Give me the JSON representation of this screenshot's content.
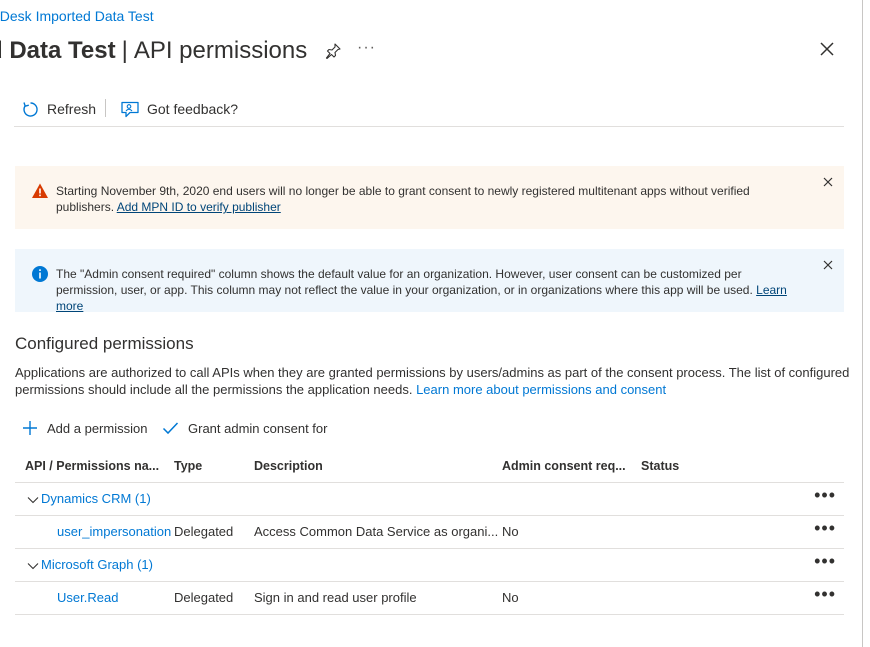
{
  "breadcrumb": "nDesk Imported Data Test",
  "title": {
    "main": "d Data Test",
    "separator": "|",
    "sub": "API permissions"
  },
  "header_icons": {
    "pin": "pin-icon",
    "more": "···",
    "close": "close-icon"
  },
  "toolbar": {
    "refresh_label": "Refresh",
    "feedback_label": "Got feedback?"
  },
  "warning_banner": {
    "text": "Starting November 9th, 2020 end users will no longer be able to grant consent to newly registered multitenant apps without verified publishers.",
    "link": "Add MPN ID to verify publisher",
    "color": "#d83b01"
  },
  "info_banner": {
    "text": "The \"Admin consent required\" column shows the default value for an organization. However, user consent can be customized per permission, user, or app. This column may not reflect the value in your organization, or in organizations where this app will be used.",
    "link": "Learn more",
    "color": "#0078d4"
  },
  "section": {
    "title": "Configured permissions",
    "description": "Applications are authorized to call APIs when they are granted permissions by users/admins as part of the consent process. The list of configured permissions should include all the permissions the application needs.",
    "link": "Learn more about permissions and consent"
  },
  "actions": {
    "add_label": "Add a permission",
    "grant_label": "Grant admin consent for"
  },
  "table": {
    "headers": [
      "API / Permissions na...",
      "Type",
      "Description",
      "Admin consent req...",
      "Status"
    ],
    "groups": [
      {
        "name": "Dynamics CRM (1)",
        "rows": [
          {
            "name": "user_impersonation",
            "type": "Delegated",
            "description": "Access Common Data Service as organi...",
            "admin": "No",
            "status": ""
          }
        ]
      },
      {
        "name": "Microsoft Graph (1)",
        "rows": [
          {
            "name": "User.Read",
            "type": "Delegated",
            "description": "Sign in and read user profile",
            "admin": "No",
            "status": ""
          }
        ]
      }
    ],
    "row_more": "•••"
  }
}
